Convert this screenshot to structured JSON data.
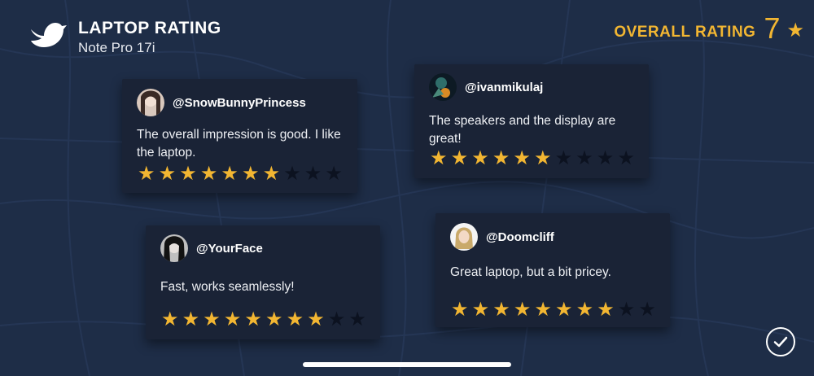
{
  "header": {
    "title": "LAPTOP RATING",
    "subtitle": "Note Pro 17i",
    "logo_icon": "bird-icon"
  },
  "overall": {
    "label": "OVERALL RATING",
    "value": "7",
    "icon": "star-icon"
  },
  "colors": {
    "background": "#1e2d47",
    "card": "#1a2336",
    "accent": "#f2b632",
    "star_off": "#0c1220"
  },
  "reviews": [
    {
      "handle": "@SnowBunnyPrincess",
      "text": "The overall impression is good. I like the laptop.",
      "rating": 7,
      "max": 10
    },
    {
      "handle": "@ivanmikulaj",
      "text": "The speakers and the display are great!",
      "rating": 6,
      "max": 10
    },
    {
      "handle": "@YourFace",
      "text": "Fast, works seamlessly!",
      "rating": 8,
      "max": 10
    },
    {
      "handle": "@Doomcliff",
      "text": "Great laptop, but a bit pricey.",
      "rating": 8,
      "max": 10
    }
  ],
  "actions": {
    "confirm_icon": "checkmark-icon"
  }
}
